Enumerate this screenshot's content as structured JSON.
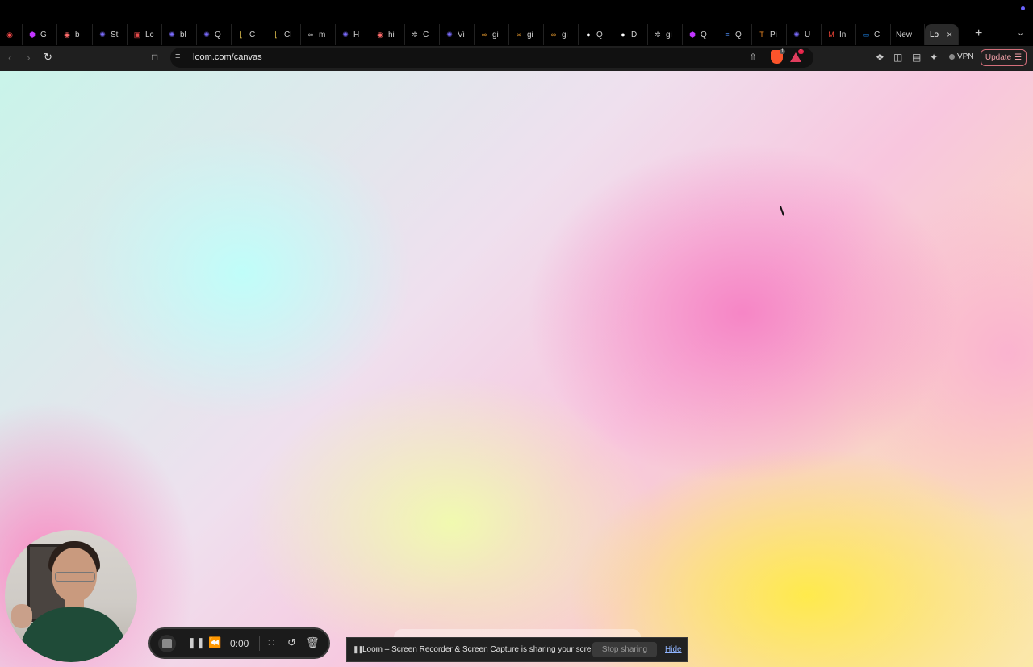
{
  "tabs": [
    {
      "label": "",
      "icon": "record-icon",
      "color": "#ff4d4d"
    },
    {
      "label": "G",
      "icon": "hexagon-icon",
      "color": "#c236ff"
    },
    {
      "label": "b",
      "icon": "record-icon",
      "color": "#ff6b6b"
    },
    {
      "label": "St",
      "icon": "gear-icon",
      "color": "#7b6cff"
    },
    {
      "label": "Lc",
      "icon": "image-icon",
      "color": "#e84b4b"
    },
    {
      "label": "bl",
      "icon": "gear-icon",
      "color": "#7b6cff"
    },
    {
      "label": "Q",
      "icon": "gear-icon",
      "color": "#7b6cff"
    },
    {
      "label": "C",
      "icon": "bracket-icon",
      "color": "#d6b84a"
    },
    {
      "label": "Cl",
      "icon": "bracket-icon",
      "color": "#d6b84a"
    },
    {
      "label": "m",
      "icon": "loop-icon",
      "color": "#cfcfcf"
    },
    {
      "label": "H",
      "icon": "gear-icon",
      "color": "#7b6cff"
    },
    {
      "label": "hi",
      "icon": "record-icon",
      "color": "#ff6b6b"
    },
    {
      "label": "C",
      "icon": "bug-icon",
      "color": "#cfcfcf"
    },
    {
      "label": "Vi",
      "icon": "gear-icon",
      "color": "#7b6cff"
    },
    {
      "label": "gi",
      "icon": "loop-icon",
      "color": "#f0a030"
    },
    {
      "label": "gi",
      "icon": "loop-icon",
      "color": "#f0a030"
    },
    {
      "label": "gi",
      "icon": "loop-icon",
      "color": "#f0a030"
    },
    {
      "label": "Q",
      "icon": "github-icon",
      "color": "#ffffff"
    },
    {
      "label": "D",
      "icon": "github-icon",
      "color": "#ffffff"
    },
    {
      "label": "gi",
      "icon": "bug-icon",
      "color": "#cfcfcf"
    },
    {
      "label": "Q",
      "icon": "hexagon-icon",
      "color": "#c236ff"
    },
    {
      "label": "Q",
      "icon": "doc-icon",
      "color": "#4a86e8"
    },
    {
      "label": "Pi",
      "icon": "tensor-icon",
      "color": "#f08a24"
    },
    {
      "label": "U",
      "icon": "gear-icon",
      "color": "#7b6cff"
    },
    {
      "label": "In",
      "icon": "gmail-icon",
      "color": "#ea4335"
    },
    {
      "label": "C",
      "icon": "calendar-icon",
      "color": "#1e90ff"
    },
    {
      "label": "New",
      "icon": "",
      "color": ""
    }
  ],
  "active_tab": {
    "label": "Lo"
  },
  "address": {
    "url": "loom.com/canvas"
  },
  "badges": {
    "brave": "1",
    "rewards": "1"
  },
  "toolbar": {
    "vpn_label": "VPN",
    "update_label": "Update"
  },
  "recorder": {
    "time": "0:00"
  },
  "share": {
    "message": "Loom – Screen Recorder & Screen Capture is sharing your screen.",
    "stop_label": "Stop sharing",
    "hide_label": "Hide"
  },
  "colors": {
    "accent_update": "#d46f7b",
    "link": "#8fb4ff"
  }
}
